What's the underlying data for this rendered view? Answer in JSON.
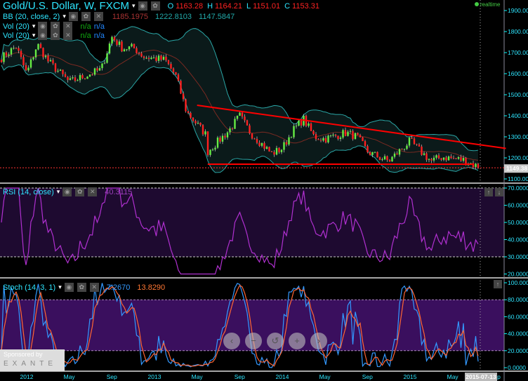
{
  "header": {
    "title": "Gold/U.S. Dollar, W, FXCM",
    "ohlc": [
      {
        "k": "O",
        "v": "1163.28"
      },
      {
        "k": "H",
        "v": "1164.21"
      },
      {
        "k": "L",
        "v": "1151.01"
      },
      {
        "k": "C",
        "v": "1153.31"
      }
    ],
    "realtime": "realtime"
  },
  "indicators": {
    "bb": {
      "label": "BB (20, close, 2)",
      "values": [
        "1185.1975",
        "1222.8103",
        "1147.5847"
      ]
    },
    "vol1": {
      "label": "Vol (20)",
      "values": [
        "n/a",
        "n/a"
      ]
    },
    "vol2": {
      "label": "Vol (20)",
      "values": [
        "n/a",
        "n/a"
      ]
    },
    "rsi": {
      "label": "RSI (14, close)",
      "value": "40.3115"
    },
    "stoch": {
      "label": "Stoch (14, 3, 1)",
      "values": [
        "7.2670",
        "13.8290"
      ]
    }
  },
  "axes": {
    "price_ticks": [
      "1900.00",
      "1800.00",
      "1700.00",
      "1600.00",
      "1500.00",
      "1400.00",
      "1300.00",
      "1200.00",
      "1100.00"
    ],
    "last_price": "1149.38",
    "rsi_ticks": [
      "70.0000",
      "60.0000",
      "50.0000",
      "40.0000",
      "30.0000",
      "20.0000"
    ],
    "stoch_ticks": [
      "100.0000",
      "80.0000",
      "60.0000",
      "40.0000",
      "20.0000",
      "0.0000"
    ],
    "time_ticks": [
      "2012",
      "May",
      "Sep",
      "2013",
      "May",
      "Sep",
      "2014",
      "May",
      "Sep",
      "2015",
      "May",
      "Sep"
    ],
    "crosshair_date": "2015-07-13"
  },
  "colors": {
    "up": "#66ee44",
    "down": "#ff2020",
    "band": "#2aa6a6",
    "rsi": "#b030d0",
    "stochK": "#3399ff",
    "stochD": "#ff6633",
    "trend": "#ff0000"
  },
  "chart_data": {
    "type": "candlestick",
    "interval": "weekly",
    "close_keypoints": [
      [
        "2011-10",
        1650
      ],
      [
        "2011-12",
        1730
      ],
      [
        "2012-01",
        1600
      ],
      [
        "2012-02",
        1740
      ],
      [
        "2012-03",
        1660
      ],
      [
        "2012-05",
        1560
      ],
      [
        "2012-07",
        1600
      ],
      [
        "2012-08",
        1620
      ],
      [
        "2012-09",
        1775
      ],
      [
        "2012-10",
        1720
      ],
      [
        "2012-11",
        1725
      ],
      [
        "2012-12",
        1680
      ],
      [
        "2013-02",
        1665
      ],
      [
        "2013-03",
        1590
      ],
      [
        "2013-04",
        1420
      ],
      [
        "2013-06",
        1300
      ],
      [
        "2013-06",
        1230
      ],
      [
        "2013-08",
        1330
      ],
      [
        "2013-09",
        1400
      ],
      [
        "2013-10",
        1320
      ],
      [
        "2013-12",
        1220
      ],
      [
        "2014-01",
        1245
      ],
      [
        "2014-02",
        1330
      ],
      [
        "2014-03",
        1385
      ],
      [
        "2014-04",
        1300
      ],
      [
        "2014-05",
        1290
      ],
      [
        "2014-07",
        1320
      ],
      [
        "2014-08",
        1300
      ],
      [
        "2014-09",
        1230
      ],
      [
        "2014-10",
        1205
      ],
      [
        "2014-11",
        1185
      ],
      [
        "2015-01",
        1280
      ],
      [
        "2015-02",
        1230
      ],
      [
        "2015-03",
        1185
      ],
      [
        "2015-04",
        1205
      ],
      [
        "2015-06",
        1190
      ],
      [
        "2015-07",
        1153
      ]
    ],
    "trendlines": [
      {
        "from": [
          "2013-05",
          1450
        ],
        "to": [
          "2015-10",
          1245
        ]
      },
      {
        "from": [
          "2013-06",
          1170
        ],
        "to": [
          "2015-07",
          1170
        ]
      }
    ],
    "rsi_levels": [
      70,
      30
    ],
    "stoch_levels": [
      80,
      20
    ],
    "price_range": [
      1100,
      1900
    ],
    "rsi_range": [
      20,
      70
    ],
    "stoch_range": [
      0,
      100
    ]
  },
  "sponsor": {
    "line1": "Sponsored by",
    "line2": "EXANTE"
  },
  "nav": [
    "‹",
    "−",
    "↺",
    "+",
    "›"
  ]
}
